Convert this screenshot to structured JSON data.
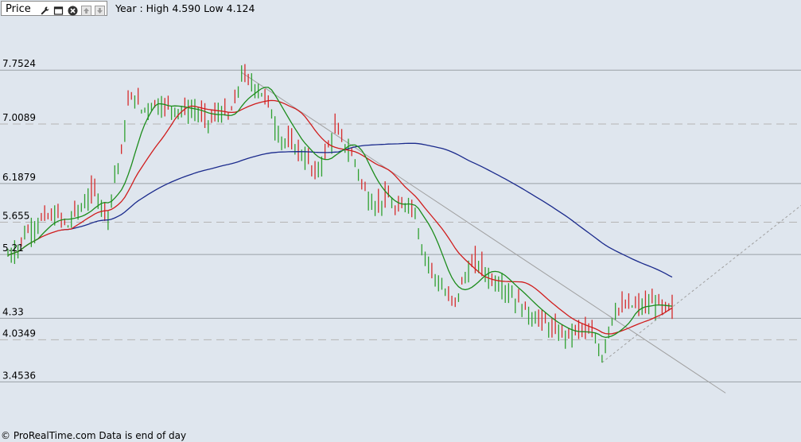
{
  "header": {
    "panel_title": "Price",
    "info_text": "Year : High 4.590 Low 4.124",
    "icons": [
      "wrench-icon",
      "window-icon",
      "close-icon",
      "move-up-icon",
      "move-down-icon"
    ]
  },
  "footer": {
    "text": "© ProRealTime.com Data is end of day"
  },
  "colors": {
    "background": "#dfe6ee",
    "candle_up": "#2fa02f",
    "candle_down": "#d62b2b",
    "ma_short": "#1c8c1c",
    "ma_medium": "#d01c1c",
    "ma_long": "#1a2a8c",
    "grid_solid": "#9aa0a6",
    "grid_dashed": "#b4b4b4",
    "trendline": "#a0a0a0"
  },
  "chart_data": {
    "type": "line",
    "y_levels": [
      {
        "value": 7.7524,
        "label": "7.7524",
        "style": "solid"
      },
      {
        "value": 7.0089,
        "label": "7.0089",
        "style": "dashed"
      },
      {
        "value": 6.1879,
        "label": "6.1879",
        "style": "solid"
      },
      {
        "value": 5.655,
        "label": "5.655",
        "style": "dashed"
      },
      {
        "value": 5.21,
        "label": "5.21",
        "style": "solid"
      },
      {
        "value": 4.33,
        "label": "4.33",
        "style": "solid"
      },
      {
        "value": 4.0349,
        "label": "4.0349",
        "style": "dashed"
      },
      {
        "value": 3.4536,
        "label": "3.4536",
        "style": "solid"
      }
    ],
    "ylim": [
      2.8,
      8.5
    ],
    "x_count": 200,
    "price_anchors": [
      [
        0,
        5.2
      ],
      [
        3,
        5.3
      ],
      [
        5,
        5.5
      ],
      [
        8,
        5.6
      ],
      [
        10,
        5.7
      ],
      [
        15,
        5.75
      ],
      [
        18,
        5.6
      ],
      [
        20,
        5.8
      ],
      [
        22,
        5.85
      ],
      [
        24,
        6.0
      ],
      [
        26,
        6.1
      ],
      [
        28,
        5.9
      ],
      [
        30,
        5.75
      ],
      [
        32,
        6.3
      ],
      [
        34,
        6.6
      ],
      [
        36,
        7.3
      ],
      [
        38,
        7.4
      ],
      [
        40,
        7.2
      ],
      [
        44,
        7.3
      ],
      [
        48,
        7.25
      ],
      [
        52,
        7.2
      ],
      [
        56,
        7.2
      ],
      [
        60,
        7.05
      ],
      [
        64,
        7.2
      ],
      [
        66,
        7.1
      ],
      [
        68,
        7.3
      ],
      [
        70,
        7.7
      ],
      [
        72,
        7.6
      ],
      [
        75,
        7.5
      ],
      [
        78,
        7.3
      ],
      [
        80,
        7.0
      ],
      [
        82,
        6.8
      ],
      [
        86,
        6.7
      ],
      [
        90,
        6.5
      ],
      [
        92,
        6.3
      ],
      [
        94,
        6.5
      ],
      [
        96,
        6.7
      ],
      [
        98,
        6.95
      ],
      [
        100,
        6.8
      ],
      [
        104,
        6.5
      ],
      [
        106,
        6.2
      ],
      [
        108,
        6.0
      ],
      [
        110,
        5.9
      ],
      [
        114,
        6.0
      ],
      [
        116,
        5.8
      ],
      [
        118,
        5.85
      ],
      [
        120,
        5.95
      ],
      [
        122,
        5.8
      ],
      [
        124,
        5.3
      ],
      [
        126,
        5.1
      ],
      [
        128,
        4.9
      ],
      [
        130,
        4.75
      ],
      [
        132,
        4.6
      ],
      [
        134,
        4.55
      ],
      [
        136,
        4.8
      ],
      [
        138,
        5.0
      ],
      [
        140,
        5.1
      ],
      [
        142,
        5.05
      ],
      [
        144,
        4.9
      ],
      [
        148,
        4.8
      ],
      [
        152,
        4.6
      ],
      [
        156,
        4.4
      ],
      [
        160,
        4.3
      ],
      [
        164,
        4.15
      ],
      [
        168,
        4.1
      ],
      [
        172,
        4.2
      ],
      [
        176,
        4.05
      ],
      [
        178,
        3.8
      ],
      [
        180,
        4.2
      ],
      [
        182,
        4.45
      ],
      [
        186,
        4.5
      ],
      [
        190,
        4.5
      ],
      [
        194,
        4.55
      ],
      [
        197,
        4.45
      ],
      [
        199,
        4.45
      ]
    ],
    "ma_periods": {
      "short": 10,
      "medium": 20,
      "long": 100
    },
    "trendlines": [
      {
        "from": [
          70,
          7.72
        ],
        "to": [
          215,
          3.3
        ],
        "style": "solid"
      },
      {
        "from": [
          178,
          3.72
        ],
        "to": [
          238,
          5.9
        ],
        "style": "dotted"
      }
    ]
  }
}
